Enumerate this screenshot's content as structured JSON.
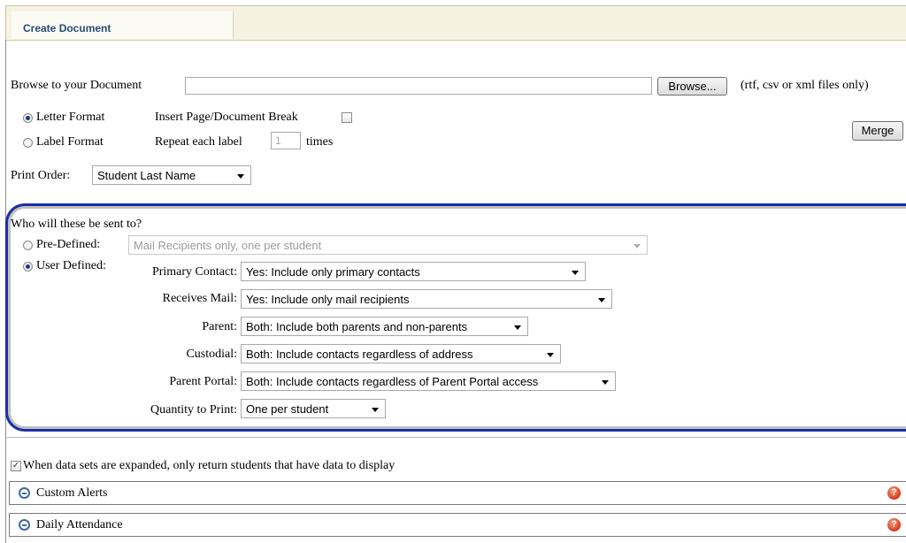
{
  "tab": {
    "title": "Create Document"
  },
  "browse": {
    "label": "Browse to your Document",
    "file_value": "",
    "button": "Browse...",
    "note": "(rtf, csv or xml files only)"
  },
  "format": {
    "letter_label": "Letter Format",
    "label_label": "Label Format",
    "selected": "Letter Format",
    "page_break_label": "Insert Page/Document Break",
    "page_break_checked": false,
    "repeat_label": "Repeat each label",
    "repeat_value": "1",
    "times_label": "times"
  },
  "merge_button": "Merge",
  "print_order": {
    "label": "Print Order:",
    "value": "Student Last Name"
  },
  "recipients": {
    "question": "Who will these be sent to?",
    "predefined_label": "Pre-Defined:",
    "predefined_value": "Mail Recipients only, one per student",
    "userdefined_label": "User Defined:",
    "selected": "User Defined",
    "fields": [
      {
        "label": "Primary Contact:",
        "value": "Yes: Include only primary contacts"
      },
      {
        "label": "Receives Mail:",
        "value": "Yes: Include only mail recipients"
      },
      {
        "label": "Parent:",
        "value": "Both: Include both parents and non-parents"
      },
      {
        "label": "Custodial:",
        "value": "Both: Include contacts regardless of address"
      },
      {
        "label": "Parent Portal:",
        "value": "Both: Include contacts regardless of Parent Portal access"
      },
      {
        "label": "Quantity to Print:",
        "value": "One per student"
      }
    ]
  },
  "expand_option": {
    "checked": true,
    "label": "When data sets are expanded, only return students that have data to display"
  },
  "sections": [
    {
      "label": "Custom Alerts",
      "help": "?"
    },
    {
      "label": "Daily Attendance",
      "help": "?"
    }
  ]
}
